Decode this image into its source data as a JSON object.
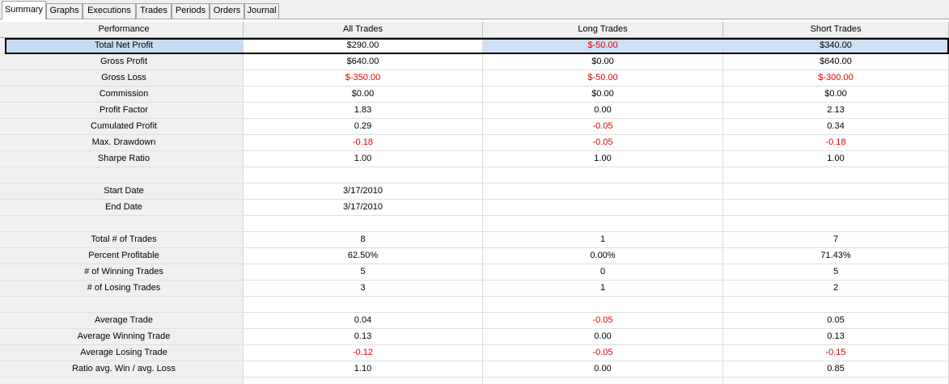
{
  "tabs": [
    {
      "label": "Summary",
      "active": true
    },
    {
      "label": "Graphs",
      "active": false
    },
    {
      "label": "Executions",
      "active": false
    },
    {
      "label": "Trades",
      "active": false
    },
    {
      "label": "Periods",
      "active": false
    },
    {
      "label": "Orders",
      "active": false
    },
    {
      "label": "Journal",
      "active": false
    }
  ],
  "table": {
    "headers": [
      "Performance",
      "All Trades",
      "Long Trades",
      "Short Trades"
    ],
    "rows": [
      {
        "label": "Total Net Profit",
        "values": [
          "$290.00",
          "$-50.00",
          "$340.00"
        ],
        "negative": [
          false,
          true,
          false
        ],
        "selected": true
      },
      {
        "label": "Gross Profit",
        "values": [
          "$640.00",
          "$0.00",
          "$640.00"
        ],
        "negative": [
          false,
          false,
          false
        ]
      },
      {
        "label": "Gross Loss",
        "values": [
          "$-350.00",
          "$-50.00",
          "$-300.00"
        ],
        "negative": [
          true,
          true,
          true
        ]
      },
      {
        "label": "Commission",
        "values": [
          "$0.00",
          "$0.00",
          "$0.00"
        ],
        "negative": [
          false,
          false,
          false
        ]
      },
      {
        "label": "Profit Factor",
        "values": [
          "1.83",
          "0.00",
          "2.13"
        ],
        "negative": [
          false,
          false,
          false
        ]
      },
      {
        "label": "Cumulated Profit",
        "values": [
          "0.29",
          "-0.05",
          "0.34"
        ],
        "negative": [
          false,
          true,
          false
        ]
      },
      {
        "label": "Max. Drawdown",
        "values": [
          "-0.18",
          "-0.05",
          "-0.18"
        ],
        "negative": [
          true,
          true,
          true
        ]
      },
      {
        "label": "Sharpe Ratio",
        "values": [
          "1.00",
          "1.00",
          "1.00"
        ],
        "negative": [
          false,
          false,
          false
        ]
      },
      {
        "label": "",
        "values": [
          "",
          "",
          ""
        ],
        "negative": [
          false,
          false,
          false
        ]
      },
      {
        "label": "Start Date",
        "values": [
          "3/17/2010",
          "",
          ""
        ],
        "negative": [
          false,
          false,
          false
        ]
      },
      {
        "label": "End Date",
        "values": [
          "3/17/2010",
          "",
          ""
        ],
        "negative": [
          false,
          false,
          false
        ]
      },
      {
        "label": "",
        "values": [
          "",
          "",
          ""
        ],
        "negative": [
          false,
          false,
          false
        ]
      },
      {
        "label": "Total # of Trades",
        "values": [
          "8",
          "1",
          "7"
        ],
        "negative": [
          false,
          false,
          false
        ]
      },
      {
        "label": "Percent Profitable",
        "values": [
          "62.50%",
          "0.00%",
          "71.43%"
        ],
        "negative": [
          false,
          false,
          false
        ]
      },
      {
        "label": "# of Winning Trades",
        "values": [
          "5",
          "0",
          "5"
        ],
        "negative": [
          false,
          false,
          false
        ]
      },
      {
        "label": "# of Losing Trades",
        "values": [
          "3",
          "1",
          "2"
        ],
        "negative": [
          false,
          false,
          false
        ]
      },
      {
        "label": "",
        "values": [
          "",
          "",
          ""
        ],
        "negative": [
          false,
          false,
          false
        ]
      },
      {
        "label": "Average Trade",
        "values": [
          "0.04",
          "-0.05",
          "0.05"
        ],
        "negative": [
          false,
          true,
          false
        ]
      },
      {
        "label": "Average Winning Trade",
        "values": [
          "0.13",
          "0.00",
          "0.13"
        ],
        "negative": [
          false,
          false,
          false
        ]
      },
      {
        "label": "Average Losing Trade",
        "values": [
          "-0.12",
          "-0.05",
          "-0.15"
        ],
        "negative": [
          true,
          true,
          true
        ]
      },
      {
        "label": "Ratio avg. Win / avg. Loss",
        "values": [
          "1.10",
          "0.00",
          "0.85"
        ],
        "negative": [
          false,
          false,
          false
        ]
      },
      {
        "label": "",
        "values": [
          "",
          "",
          ""
        ],
        "negative": [
          false,
          false,
          false
        ]
      }
    ]
  },
  "colors": {
    "negative": "#e00000",
    "selection": "#c6dcf4"
  }
}
